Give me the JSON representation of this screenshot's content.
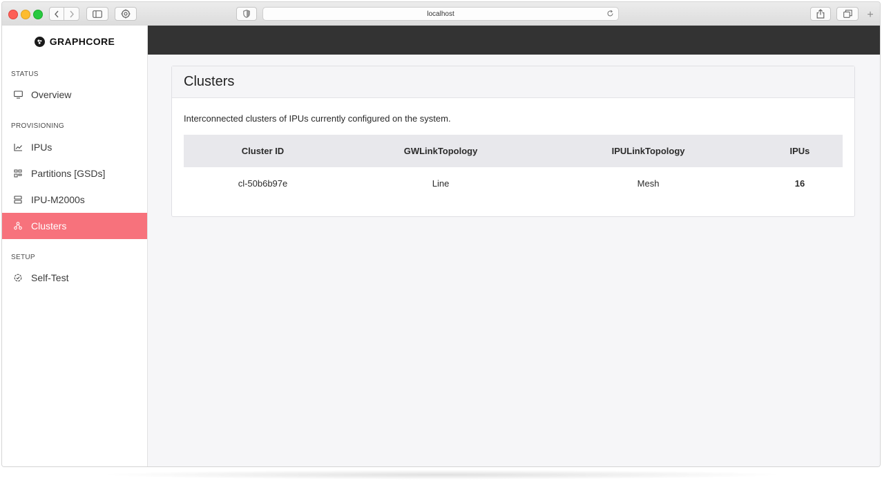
{
  "browser": {
    "url": "localhost"
  },
  "sidebar": {
    "logo_text": "GRAPHCORE",
    "sections": [
      {
        "title": "STATUS",
        "items": [
          {
            "label": "Overview",
            "icon": "monitor-icon"
          }
        ]
      },
      {
        "title": "PROVISIONING",
        "items": [
          {
            "label": "IPUs",
            "icon": "chart-line-icon"
          },
          {
            "label": "Partitions [GSDs]",
            "icon": "partition-grid-icon"
          },
          {
            "label": "IPU-M2000s",
            "icon": "server-icon"
          },
          {
            "label": "Clusters",
            "icon": "cluster-icon",
            "active": true
          }
        ]
      },
      {
        "title": "SETUP",
        "items": [
          {
            "label": "Self-Test",
            "icon": "dial-icon"
          }
        ]
      }
    ],
    "active_color": "#f7727c"
  },
  "page": {
    "title": "Clusters",
    "description": "Interconnected clusters of IPUs currently configured on the system.",
    "table": {
      "columns": [
        "Cluster ID",
        "GWLinkTopology",
        "IPULinkTopology",
        "IPUs"
      ],
      "rows": [
        [
          "cl-50b6b97e",
          "Line",
          "Mesh",
          "16"
        ]
      ]
    }
  },
  "colors": {
    "topbar": "#333333",
    "table_header": "#e8e8ec"
  }
}
